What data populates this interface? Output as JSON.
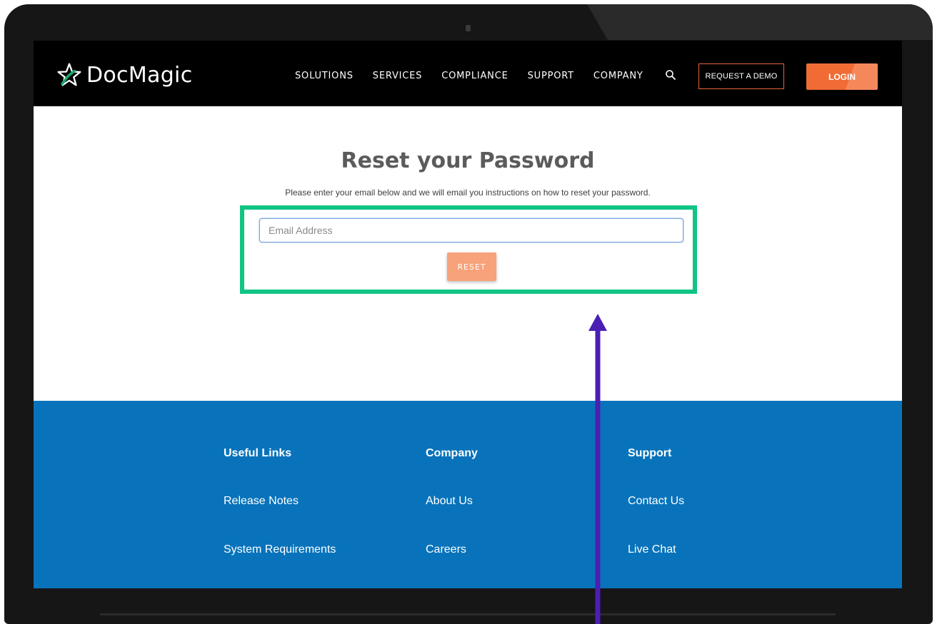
{
  "brand": {
    "name": "DocMagic"
  },
  "nav": {
    "items": [
      "SOLUTIONS",
      "SERVICES",
      "COMPLIANCE",
      "SUPPORT",
      "COMPANY"
    ],
    "demo_label": "REQUEST A DEMO",
    "login_label": "LOGIN"
  },
  "main": {
    "title": "Reset your Password",
    "instructions": "Please enter your email below and we will email you instructions on how to reset your password.",
    "email_placeholder": "Email Address",
    "email_value": "",
    "reset_label": "RESET"
  },
  "footer": {
    "columns": [
      {
        "title": "Useful Links",
        "links": [
          "Release Notes",
          "System Requirements"
        ]
      },
      {
        "title": "Company",
        "links": [
          "About Us",
          "Careers"
        ]
      },
      {
        "title": "Support",
        "links": [
          "Contact Us",
          "Live Chat"
        ]
      }
    ]
  },
  "colors": {
    "accent": "#f06c34",
    "footer_bg": "#0873bb",
    "highlight": "#10c484",
    "arrow": "#4b1fb3"
  },
  "icons": [
    "star-logo-icon",
    "search-icon",
    "arrow-up-icon"
  ]
}
